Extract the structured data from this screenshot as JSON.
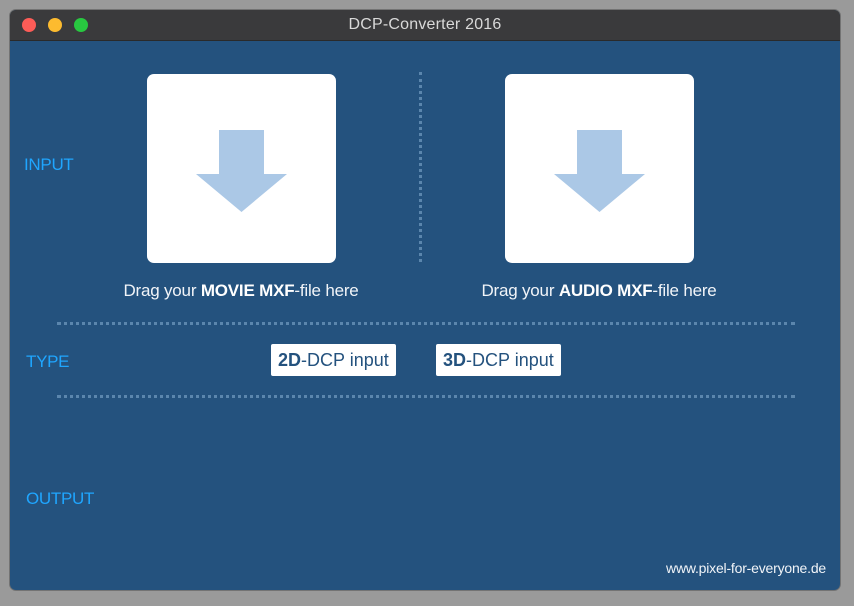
{
  "window": {
    "title": "DCP-Converter 2016"
  },
  "traffic_lights": {
    "close_color": "#fd5c57",
    "minimize_color": "#fdbb2f",
    "zoom_color": "#28c840"
  },
  "sections": {
    "input_label": "INPUT",
    "type_label": "TYPE",
    "output_label": "OUTPUT"
  },
  "input": {
    "movie": {
      "icon": "arrow-down-icon",
      "caption_prefix": "Drag your ",
      "caption_bold": "MOVIE MXF",
      "caption_suffix": "-file here"
    },
    "audio": {
      "icon": "arrow-down-icon",
      "caption_prefix": "Drag your ",
      "caption_bold": "AUDIO MXF",
      "caption_suffix": "-file here"
    }
  },
  "type": {
    "options": [
      {
        "bold": "2D",
        "rest": "-DCP input"
      },
      {
        "bold": "3D",
        "rest": "-DCP input"
      }
    ]
  },
  "footer": {
    "link_text": "www.pixel-for-everyone.de"
  },
  "colors": {
    "background": "#24527e",
    "accent": "#1fa6ff",
    "arrow": "#abc8e6",
    "titlebar": "#3a3a3c"
  }
}
